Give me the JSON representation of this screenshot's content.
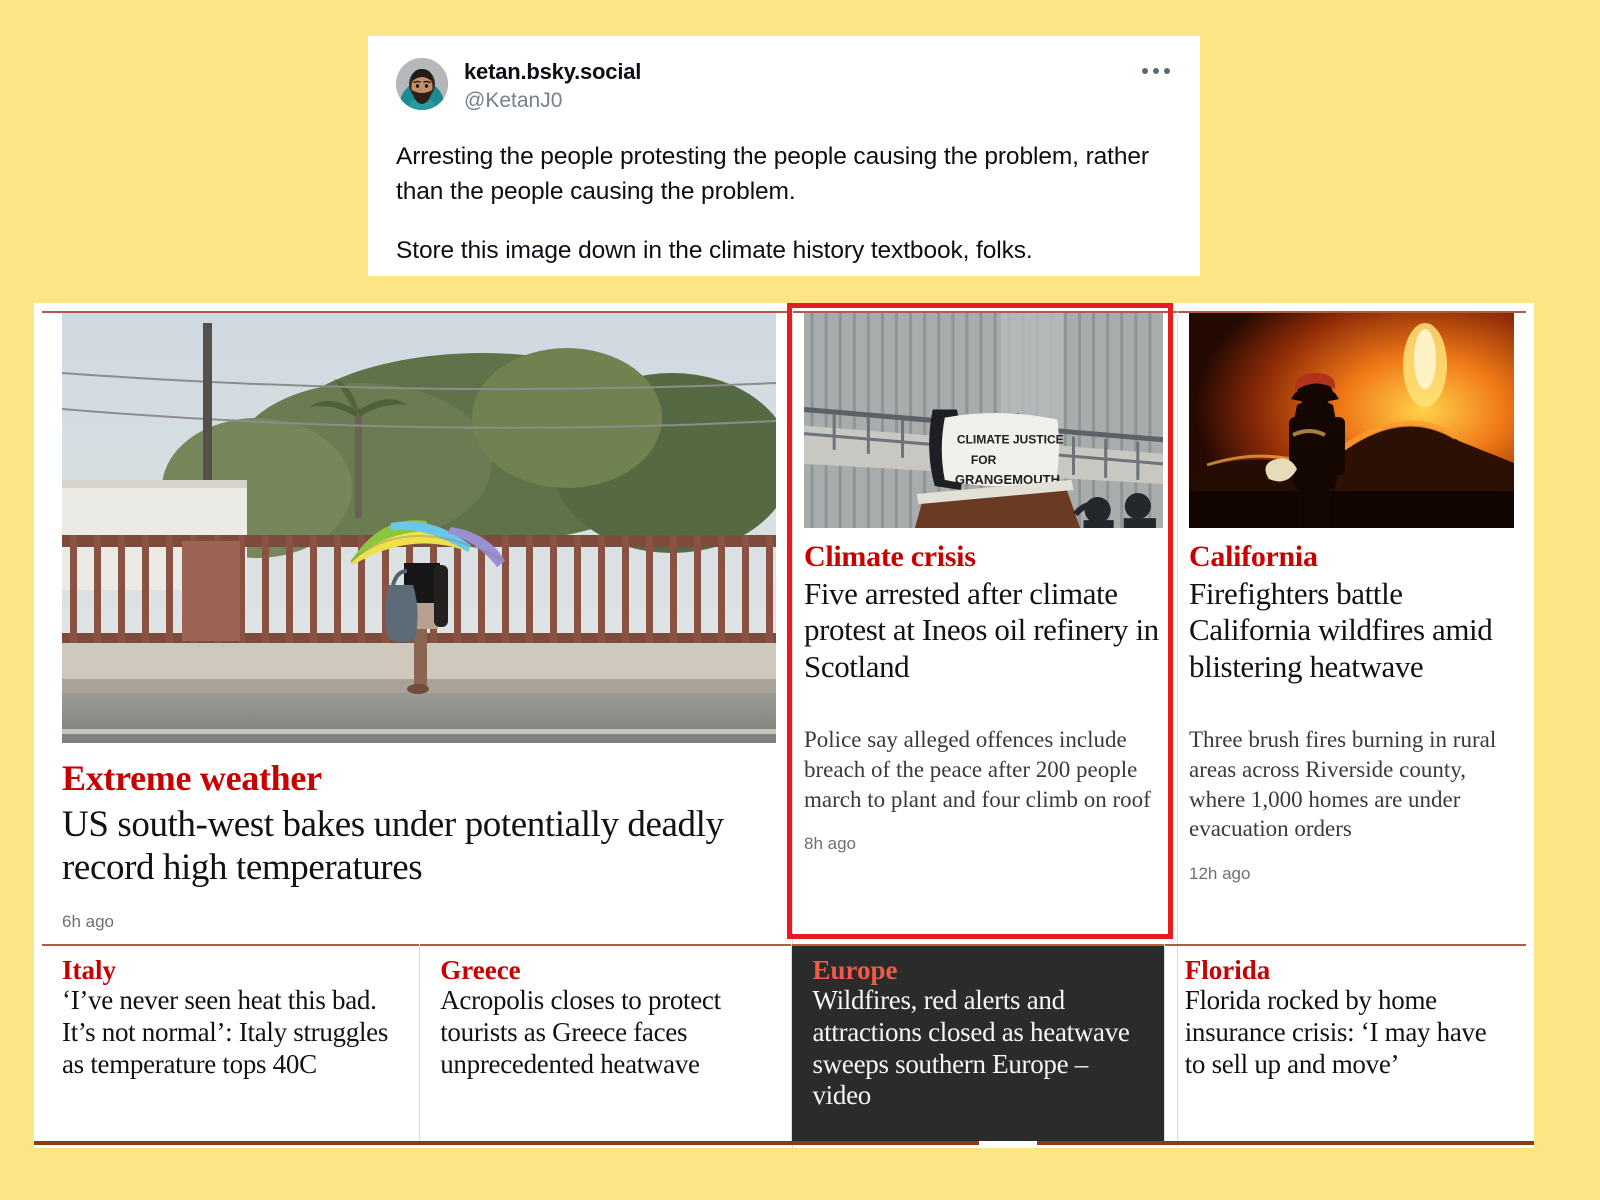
{
  "colors": {
    "page_background": "#FCE585",
    "guardian_red": "#C70000",
    "highlight_box": "#E81C1C",
    "dark_card_bg": "#2B2B2B",
    "dark_card_kicker": "#EE5B46"
  },
  "post": {
    "display_name": "ketan.bsky.social",
    "handle": "@KetanJ0",
    "more_label": "···",
    "avatar_alt": "avatar",
    "paragraph_1": "Arresting the people protesting the people causing the problem, rather than the people causing the problem.",
    "paragraph_2": "Store this image down in the climate history textbook, folks."
  },
  "guardian": {
    "lead": {
      "kicker": "Extreme weather",
      "headline": "US south-west bakes under potentially deadly record high temperatures",
      "timestamp": "6h ago",
      "photo_alt": "person-with-rainbow-umbrella-photo"
    },
    "middle": {
      "kicker": "Climate crisis",
      "headline": "Five arrested after climate protest at Ineos oil refinery in Scotland",
      "standfirst": "Police say alleged offences include breach of the peace after 200 people march to plant and four climb on roof",
      "timestamp": "8h ago",
      "photo_alt": "protest-banner-photo",
      "banner_line_1": "CLIMATE JUSTICE",
      "banner_line_2": "FOR",
      "banner_line_3": "GRANGEMOUTH"
    },
    "right": {
      "kicker": "California",
      "headline": "Firefighters battle California wildfires amid blistering heatwave",
      "standfirst": "Three brush fires burning in rural areas across Riverside county, where 1,000 homes are under evacuation orders",
      "timestamp": "12h ago",
      "photo_alt": "wildfire-firefighter-photo"
    },
    "small_cards": [
      {
        "kicker": "Italy",
        "headline": "‘I’ve never seen heat this bad. It’s not normal’: Italy struggles as temperature tops 40C"
      },
      {
        "kicker": "Greece",
        "headline": "Acropolis closes to protect tourists as Greece faces unprecedented heatwave"
      },
      {
        "kicker": "Europe",
        "headline": "Wildfires, red alerts and attractions closed as heatwave sweeps southern Europe – video"
      },
      {
        "kicker": "Florida",
        "headline": "Florida rocked by home insurance crisis: ‘I may have to sell up and move’"
      }
    ]
  }
}
